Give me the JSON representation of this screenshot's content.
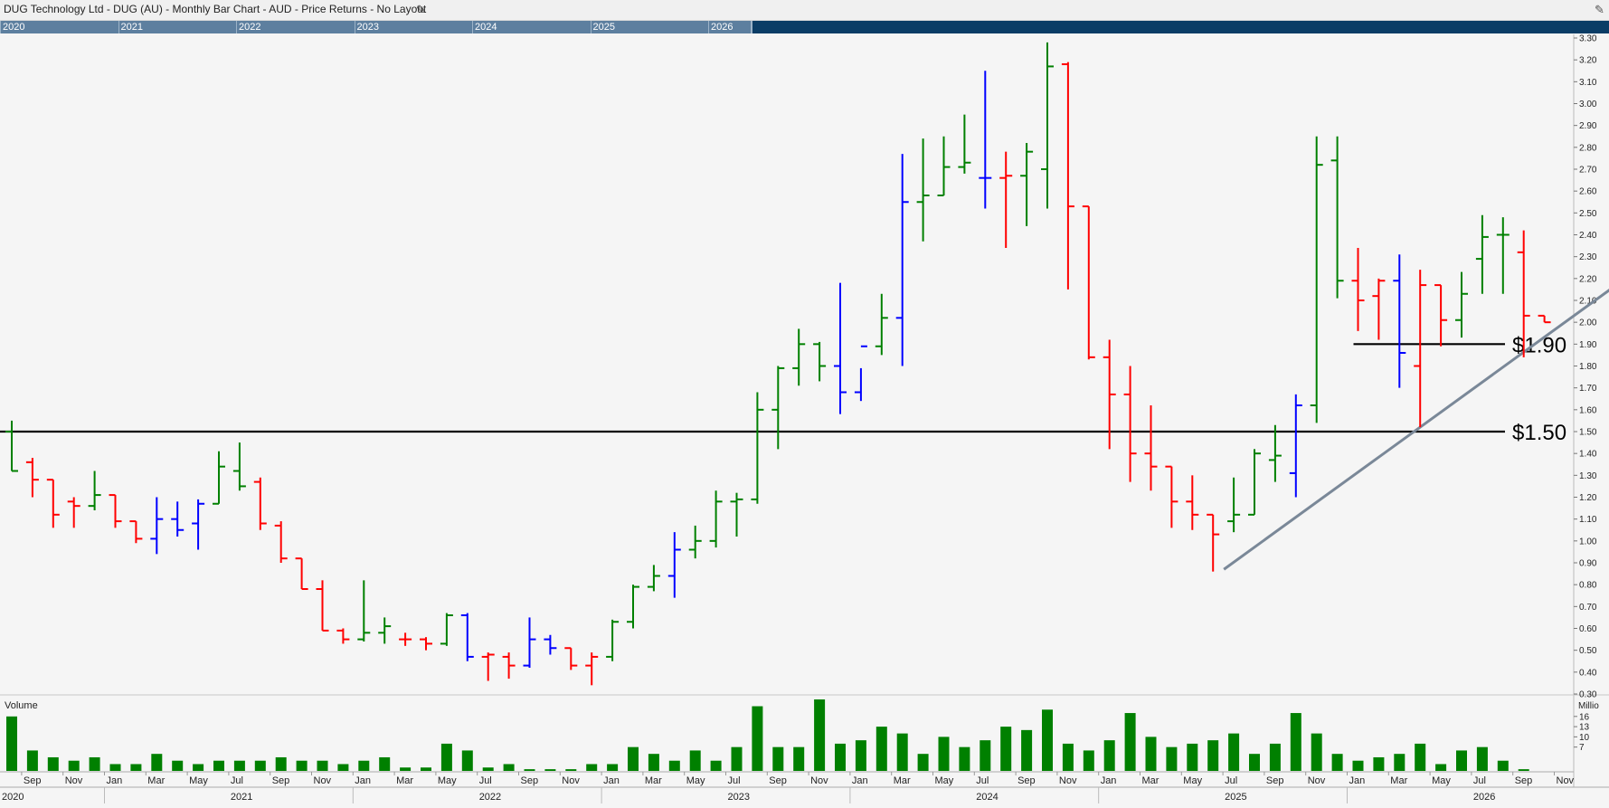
{
  "title": "DUG Technology Ltd - DUG (AU) - Monthly Bar Chart - AUD - Price Returns - No Layout",
  "navigator": {
    "years": [
      "2020",
      "2021",
      "2022",
      "2023",
      "2024",
      "2025",
      "2026"
    ]
  },
  "chart_data": {
    "type": "ohlc-bar",
    "interval": "monthly",
    "currency": "AUD",
    "x_start": "2020-08",
    "ylim": [
      0.3,
      3.3
    ],
    "yticks": [
      "3.30",
      "3.20",
      "3.10",
      "3.00",
      "2.90",
      "2.80",
      "2.70",
      "2.60",
      "2.50",
      "2.40",
      "2.30",
      "2.20",
      "2.10",
      "2.00",
      "1.90",
      "1.80",
      "1.70",
      "1.60",
      "1.50",
      "1.40",
      "1.30",
      "1.20",
      "1.10",
      "1.00",
      "0.90",
      "0.80",
      "0.70",
      "0.60",
      "0.50",
      "0.40",
      "0.30"
    ],
    "colors": {
      "up": "#008000",
      "down": "#ff0000",
      "neutral": "#0000ff",
      "trendline": "#7a8898",
      "level": "#000000",
      "volume": "#008000"
    },
    "bars": [
      [
        "2020-08",
        1.5,
        1.55,
        1.32,
        1.32,
        "up"
      ],
      [
        "2020-09",
        1.36,
        1.38,
        1.2,
        1.28,
        "down"
      ],
      [
        "2020-10",
        1.28,
        1.28,
        1.06,
        1.12,
        "down"
      ],
      [
        "2020-11",
        1.18,
        1.2,
        1.06,
        1.16,
        "down"
      ],
      [
        "2020-12",
        1.16,
        1.32,
        1.14,
        1.21,
        "up"
      ],
      [
        "2021-01",
        1.21,
        1.21,
        1.06,
        1.09,
        "down"
      ],
      [
        "2021-02",
        1.09,
        1.09,
        0.99,
        1.01,
        "down"
      ],
      [
        "2021-03",
        1.01,
        1.2,
        0.94,
        1.1,
        "neutral"
      ],
      [
        "2021-04",
        1.1,
        1.18,
        1.02,
        1.05,
        "neutral"
      ],
      [
        "2021-05",
        1.08,
        1.19,
        0.96,
        1.17,
        "neutral"
      ],
      [
        "2021-06",
        1.17,
        1.41,
        1.17,
        1.34,
        "up"
      ],
      [
        "2021-07",
        1.32,
        1.45,
        1.23,
        1.25,
        "up"
      ],
      [
        "2021-08",
        1.27,
        1.29,
        1.05,
        1.08,
        "down"
      ],
      [
        "2021-09",
        1.07,
        1.09,
        0.9,
        0.92,
        "down"
      ],
      [
        "2021-10",
        0.92,
        0.92,
        0.78,
        0.78,
        "down"
      ],
      [
        "2021-11",
        0.78,
        0.82,
        0.59,
        0.59,
        "down"
      ],
      [
        "2021-12",
        0.59,
        0.6,
        0.53,
        0.55,
        "down"
      ],
      [
        "2022-01",
        0.55,
        0.82,
        0.54,
        0.58,
        "up"
      ],
      [
        "2022-02",
        0.58,
        0.65,
        0.53,
        0.61,
        "up"
      ],
      [
        "2022-03",
        0.55,
        0.58,
        0.52,
        0.55,
        "down"
      ],
      [
        "2022-04",
        0.55,
        0.56,
        0.5,
        0.53,
        "down"
      ],
      [
        "2022-05",
        0.53,
        0.67,
        0.52,
        0.66,
        "up"
      ],
      [
        "2022-06",
        0.66,
        0.67,
        0.45,
        0.47,
        "neutral"
      ],
      [
        "2022-07",
        0.47,
        0.49,
        0.36,
        0.48,
        "down"
      ],
      [
        "2022-08",
        0.47,
        0.49,
        0.37,
        0.43,
        "down"
      ],
      [
        "2022-09",
        0.43,
        0.65,
        0.42,
        0.55,
        "neutral"
      ],
      [
        "2022-10",
        0.55,
        0.57,
        0.48,
        0.51,
        "neutral"
      ],
      [
        "2022-11",
        0.51,
        0.51,
        0.41,
        0.43,
        "down"
      ],
      [
        "2022-12",
        0.43,
        0.49,
        0.34,
        0.47,
        "down"
      ],
      [
        "2023-01",
        0.47,
        0.64,
        0.45,
        0.63,
        "up"
      ],
      [
        "2023-02",
        0.63,
        0.8,
        0.6,
        0.79,
        "up"
      ],
      [
        "2023-03",
        0.79,
        0.89,
        0.77,
        0.84,
        "up"
      ],
      [
        "2023-04",
        0.84,
        1.04,
        0.74,
        0.96,
        "neutral"
      ],
      [
        "2023-05",
        0.96,
        1.07,
        0.92,
        1.0,
        "up"
      ],
      [
        "2023-06",
        1.0,
        1.23,
        0.97,
        1.18,
        "up"
      ],
      [
        "2023-07",
        1.18,
        1.22,
        1.02,
        1.19,
        "up"
      ],
      [
        "2023-08",
        1.19,
        1.68,
        1.17,
        1.6,
        "up"
      ],
      [
        "2023-09",
        1.6,
        1.8,
        1.42,
        1.79,
        "up"
      ],
      [
        "2023-10",
        1.79,
        1.97,
        1.71,
        1.9,
        "up"
      ],
      [
        "2023-11",
        1.9,
        1.91,
        1.73,
        1.8,
        "up"
      ],
      [
        "2023-12",
        1.8,
        2.18,
        1.58,
        1.68,
        "neutral"
      ],
      [
        "2024-01",
        1.68,
        1.79,
        1.64,
        1.89,
        "neutral"
      ],
      [
        "2024-02",
        1.89,
        2.13,
        1.85,
        2.02,
        "up"
      ],
      [
        "2024-03",
        2.02,
        2.77,
        1.8,
        2.55,
        "neutral"
      ],
      [
        "2024-04",
        2.55,
        2.84,
        2.37,
        2.58,
        "up"
      ],
      [
        "2024-05",
        2.58,
        2.85,
        2.58,
        2.71,
        "up"
      ],
      [
        "2024-06",
        2.71,
        2.95,
        2.68,
        2.73,
        "up"
      ],
      [
        "2024-07",
        2.66,
        3.15,
        2.52,
        2.66,
        "neutral"
      ],
      [
        "2024-08",
        2.66,
        2.78,
        2.34,
        2.67,
        "down"
      ],
      [
        "2024-09",
        2.67,
        2.82,
        2.44,
        2.78,
        "up"
      ],
      [
        "2024-10",
        2.7,
        3.28,
        2.52,
        3.17,
        "up"
      ],
      [
        "2024-11",
        3.18,
        3.19,
        2.15,
        2.53,
        "down"
      ],
      [
        "2024-12",
        2.53,
        2.53,
        1.83,
        1.84,
        "down"
      ],
      [
        "2025-01",
        1.84,
        1.92,
        1.42,
        1.67,
        "down"
      ],
      [
        "2025-02",
        1.67,
        1.8,
        1.27,
        1.4,
        "down"
      ],
      [
        "2025-03",
        1.4,
        1.62,
        1.23,
        1.34,
        "down"
      ],
      [
        "2025-04",
        1.34,
        1.34,
        1.06,
        1.18,
        "down"
      ],
      [
        "2025-05",
        1.18,
        1.3,
        1.05,
        1.12,
        "down"
      ],
      [
        "2025-06",
        1.12,
        1.12,
        0.86,
        1.03,
        "down"
      ],
      [
        "2025-07",
        1.09,
        1.29,
        1.04,
        1.12,
        "up"
      ],
      [
        "2025-08",
        1.12,
        1.42,
        1.12,
        1.4,
        "up"
      ],
      [
        "2025-09",
        1.37,
        1.53,
        1.27,
        1.39,
        "up"
      ],
      [
        "2025-10",
        1.31,
        1.67,
        1.2,
        1.62,
        "neutral"
      ],
      [
        "2025-11",
        1.62,
        2.85,
        1.54,
        2.72,
        "up"
      ],
      [
        "2025-12",
        2.74,
        2.85,
        2.11,
        2.19,
        "up"
      ],
      [
        "2026-01",
        2.19,
        2.34,
        1.96,
        2.1,
        "down"
      ],
      [
        "2026-02",
        2.12,
        2.2,
        1.92,
        2.19,
        "down"
      ],
      [
        "2026-03",
        2.19,
        2.31,
        1.7,
        1.86,
        "neutral"
      ],
      [
        "2026-04",
        1.8,
        2.24,
        1.52,
        2.17,
        "down"
      ],
      [
        "2026-05",
        2.17,
        2.17,
        1.89,
        2.01,
        "down"
      ],
      [
        "2026-06",
        2.01,
        2.23,
        1.93,
        2.13,
        "up"
      ],
      [
        "2026-07",
        2.29,
        2.49,
        2.13,
        2.39,
        "up"
      ],
      [
        "2026-08",
        2.4,
        2.48,
        2.13,
        2.4,
        "up"
      ],
      [
        "2026-09",
        2.32,
        2.42,
        1.84,
        2.03,
        "down"
      ],
      [
        "2026-10",
        2.03,
        2.03,
        2.0,
        2.0,
        "down"
      ]
    ],
    "levels": [
      {
        "label": "$1.50",
        "value": 1.5,
        "from": "2020-08"
      },
      {
        "label": "$1.90",
        "value": 1.9,
        "from": "2026-01"
      }
    ],
    "trendline": {
      "from": [
        "2025-06",
        0.87
      ],
      "to": [
        "2027-01",
        2.15
      ]
    },
    "volume": {
      "title": "Volume",
      "unit_label": "Millio",
      "yticks": [
        "16",
        "13",
        "10",
        "7"
      ],
      "ylim": [
        0,
        21
      ],
      "values": [
        16,
        6,
        4,
        3,
        4,
        2,
        2,
        5,
        3,
        2,
        3,
        3,
        3,
        4,
        3,
        3,
        2,
        3,
        4,
        1,
        1,
        8,
        6,
        1,
        2,
        0.5,
        0.5,
        0.5,
        2,
        2,
        7,
        5,
        3,
        6,
        3,
        7,
        19,
        7,
        7,
        21,
        8,
        9,
        13,
        11,
        5,
        10,
        7,
        9,
        13,
        12,
        18,
        8,
        6,
        9,
        17,
        10,
        7,
        8,
        9,
        11,
        5,
        8,
        17,
        11,
        5,
        3,
        4,
        5,
        8,
        2,
        6,
        7,
        3,
        0.5
      ],
      "color": "#008000"
    },
    "x_month_labels": [
      "Sep",
      "Nov",
      "Jan",
      "Mar",
      "May",
      "Jul",
      "Sep",
      "Nov",
      "Jan",
      "Mar",
      "May",
      "Jul",
      "Sep",
      "Nov",
      "Jan",
      "Mar",
      "May",
      "Jul",
      "Sep",
      "Nov",
      "Jan",
      "Mar",
      "May",
      "Jul",
      "Sep",
      "Nov",
      "Jan",
      "Mar",
      "May",
      "Jul",
      "Sep",
      "Nov",
      "Jan",
      "Mar",
      "May",
      "Jul",
      "Sep",
      "Nov"
    ],
    "x_year_labels": [
      "2020",
      "2021",
      "2022",
      "2023",
      "2024",
      "2025",
      "2026"
    ]
  }
}
